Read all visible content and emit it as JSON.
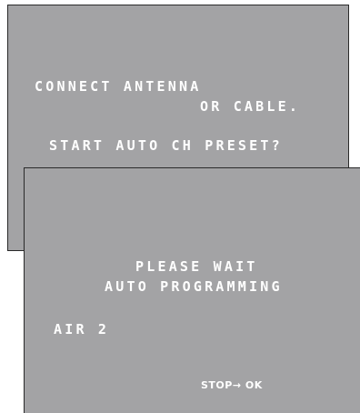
{
  "background_screen": {
    "line1": "CONNECT ANTENNA",
    "line2": "OR CABLE.",
    "line3": "START AUTO CH PRESET?"
  },
  "foreground_screen": {
    "line1": "PLEASE WAIT",
    "line2": "AUTO PROGRAMMING",
    "channel": "AIR 2",
    "stop_hint": "STOP→ OK"
  },
  "colors": {
    "screen_bg": "#a3a3a5",
    "text": "#ffffff",
    "border": "#2a2a2a"
  }
}
